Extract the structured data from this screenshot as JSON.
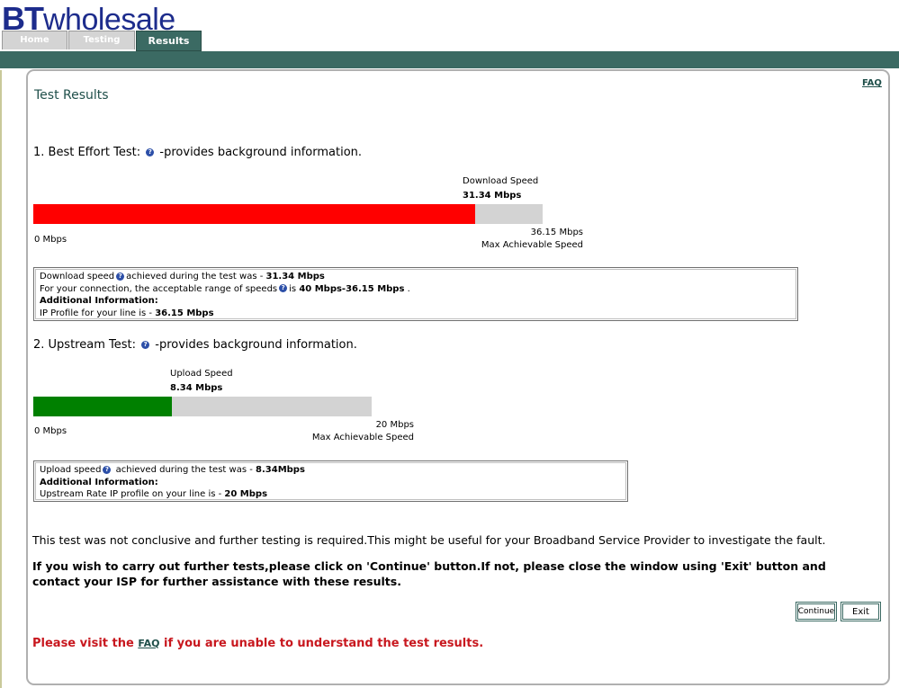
{
  "brand": {
    "bt": "BT",
    "wholesale": "wholesale"
  },
  "tabs": [
    {
      "label": "Home",
      "active": false
    },
    {
      "label": "Testing",
      "active": false
    },
    {
      "label": "Results",
      "active": true
    }
  ],
  "page": {
    "title": "Test Results",
    "faq_link": "FAQ"
  },
  "best_effort": {
    "heading": "1. Best Effort Test:",
    "help_text": "-provides background information.",
    "speed_label": "Download Speed",
    "speed_value": "31.34 Mbps",
    "min_label": "0 Mbps",
    "max_value": "36.15 Mbps",
    "max_label": "Max Achievable Speed",
    "fill_fraction": 0.867,
    "fill_color": "#ff0000",
    "info": {
      "line1_prefix": "Download speed",
      "line1_mid": "achieved during the test was - ",
      "line1_value": "31.34 Mbps",
      "line2_prefix": "For your connection, the acceptable range of speeds",
      "line2_mid": "is ",
      "line2_value": "40 Mbps-36.15 Mbps",
      "line2_suffix": " .",
      "additional_label": "Additional Information:",
      "line4_prefix": "IP Profile for your line is - ",
      "line4_value": "36.15 Mbps"
    }
  },
  "upstream": {
    "heading": "2. Upstream Test:",
    "help_text": "-provides background information.",
    "speed_label": "Upload Speed",
    "speed_value": "8.34 Mbps",
    "min_label": "0 Mbps",
    "max_value": "20 Mbps",
    "max_label": "Max Achievable Speed",
    "fill_fraction": 0.41,
    "fill_color": "#008000",
    "info": {
      "line1_prefix": "Upload speed",
      "line1_mid": " achieved during the test was - ",
      "line1_value": "8.34Mbps",
      "additional_label": "Additional Information:",
      "line3_prefix": "Upstream Rate IP profile on your line is - ",
      "line3_value": "20 Mbps"
    }
  },
  "messages": {
    "inconclusive": "This test was not conclusive and further testing is required.This might be useful for your Broadband Service Provider to investigate the fault.",
    "instructions": "If you wish to carry out further tests,please click on 'Continue' button.If not, please close the window using 'Exit' button and contact your ISP for further assistance with these results."
  },
  "buttons": {
    "continue": "Continue",
    "exit": "Exit"
  },
  "faq_notice": {
    "before": "Please visit the ",
    "link": "FAQ",
    "after": " if you are unable to understand the test results."
  },
  "icons": {
    "help": "help-question-icon"
  },
  "colors": {
    "brand_blue": "#1d2c8c",
    "header_band": "#3b6a63",
    "notice_red": "#c8171e"
  }
}
